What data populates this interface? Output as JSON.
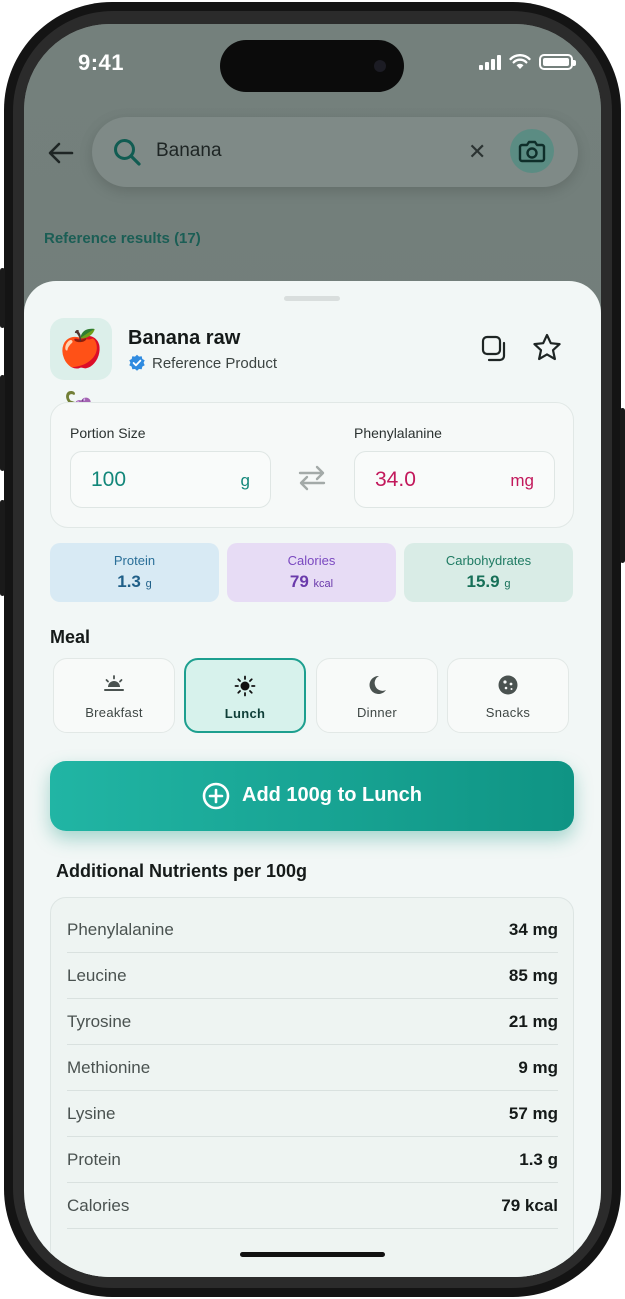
{
  "status_bar": {
    "time": "9:41"
  },
  "search": {
    "query": "Banana"
  },
  "reference_results_label": "Reference results (17)",
  "product": {
    "icon": "🍎🍇",
    "name": "Banana raw",
    "verified_label": "Reference Product"
  },
  "portion": {
    "portion_label": "Portion Size",
    "portion_value": "100",
    "portion_unit": "g",
    "phe_label": "Phenylalanine",
    "phe_value": "34.0",
    "phe_unit": "mg"
  },
  "macros": [
    {
      "label": "Protein",
      "value": "1.3",
      "unit": "g"
    },
    {
      "label": "Calories",
      "value": "79",
      "unit": "kcal"
    },
    {
      "label": "Carbohydrates",
      "value": "15.9",
      "unit": "g"
    }
  ],
  "meal": {
    "title": "Meal",
    "options": [
      {
        "label": "Breakfast",
        "icon": "sunrise-icon"
      },
      {
        "label": "Lunch",
        "icon": "sun-icon"
      },
      {
        "label": "Dinner",
        "icon": "moon-icon"
      },
      {
        "label": "Snacks",
        "icon": "cookie-icon"
      }
    ],
    "selected": "Lunch"
  },
  "add_button_label": "Add 100g to Lunch",
  "nutrients": {
    "title": "Additional Nutrients per 100g",
    "rows": [
      {
        "name": "Phenylalanine",
        "value": "34 mg"
      },
      {
        "name": "Leucine",
        "value": "85 mg"
      },
      {
        "name": "Tyrosine",
        "value": "21 mg"
      },
      {
        "name": "Methionine",
        "value": "9 mg"
      },
      {
        "name": "Lysine",
        "value": "57 mg"
      },
      {
        "name": "Protein",
        "value": "1.3 g"
      },
      {
        "name": "Calories",
        "value": "79 kcal"
      }
    ]
  },
  "colors": {
    "accent": "#1d9f8f",
    "protein_bg": "#d8eaf4",
    "calories_bg": "#e7dcf5",
    "carbs_bg": "#d9ece6",
    "phe_value": "#c2185b"
  }
}
